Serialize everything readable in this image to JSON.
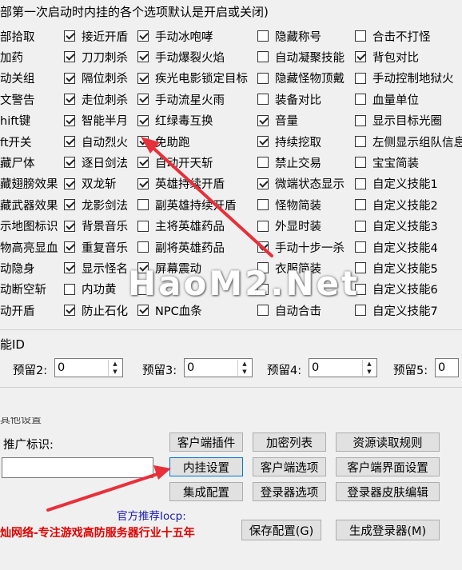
{
  "header": {
    "title": "部第一次启动时内挂的各个选项默认是开启或关闭)"
  },
  "options": {
    "col0": [
      "部拾取",
      "加药",
      "动关组",
      "文警告",
      "hift键",
      "ft开关",
      "藏尸体",
      "藏翅膀效果",
      "藏武器效果",
      "示地图标识",
      "物高亮显血",
      "动隐身",
      "动断空斩",
      "动开盾"
    ],
    "col1": [
      {
        "label": "接近开盾",
        "checked": true
      },
      {
        "label": "刀刀刺杀",
        "checked": true
      },
      {
        "label": "隔位刺杀",
        "checked": true
      },
      {
        "label": "走位刺杀",
        "checked": true
      },
      {
        "label": "智能半月",
        "checked": true
      },
      {
        "label": "自动烈火",
        "checked": true
      },
      {
        "label": "逐日剑法",
        "checked": true
      },
      {
        "label": "双龙斩",
        "checked": true
      },
      {
        "label": "龙影剑法",
        "checked": true
      },
      {
        "label": "背景音乐",
        "checked": true
      },
      {
        "label": "重复音乐",
        "checked": true
      },
      {
        "label": "显示怪名",
        "checked": true
      },
      {
        "label": "内功黄",
        "checked": false
      },
      {
        "label": "防止石化",
        "checked": true
      }
    ],
    "col2": [
      {
        "label": "手动冰咆哮",
        "checked": true
      },
      {
        "label": "手动爆裂火焰",
        "checked": true
      },
      {
        "label": "疾光电影锁定目标",
        "checked": true
      },
      {
        "label": "手动流星火雨",
        "checked": true
      },
      {
        "label": "红绿毒互换",
        "checked": true
      },
      {
        "label": "免助跑",
        "checked": true
      },
      {
        "label": "自动开天斩",
        "checked": true
      },
      {
        "label": "英雄持续开盾",
        "checked": true
      },
      {
        "label": "副英雄持续开盾",
        "checked": false
      },
      {
        "label": "主将英雄药品",
        "checked": false
      },
      {
        "label": "副将英雄药品",
        "checked": false
      },
      {
        "label": "屏幕震动",
        "checked": true
      },
      {
        "label": "",
        "checked": false
      },
      {
        "label": "NPC血条",
        "checked": true
      }
    ],
    "col3": [
      {
        "label": "隐藏称号",
        "checked": false
      },
      {
        "label": "自动凝聚技能",
        "checked": false
      },
      {
        "label": "隐藏怪物顶戴",
        "checked": false
      },
      {
        "label": "装备对比",
        "checked": false
      },
      {
        "label": "音量",
        "checked": true
      },
      {
        "label": "持续挖取",
        "checked": true
      },
      {
        "label": "禁止交易",
        "checked": false
      },
      {
        "label": "微端状态显示",
        "checked": true
      },
      {
        "label": "怪物简装",
        "checked": false
      },
      {
        "label": "外显时装",
        "checked": false
      },
      {
        "label": "手动十步一杀",
        "checked": true
      },
      {
        "label": "衣服简装",
        "checked": false
      },
      {
        "label": "",
        "checked": false
      },
      {
        "label": "自动合击",
        "checked": false
      }
    ],
    "col4": [
      {
        "label": "合击不打怪",
        "checked": false
      },
      {
        "label": "背包对比",
        "checked": true
      },
      {
        "label": "手动控制地狱火",
        "checked": false
      },
      {
        "label": "血量单位",
        "checked": false
      },
      {
        "label": "显示目标光圈",
        "checked": false
      },
      {
        "label": "左侧显示组队信息",
        "checked": false
      },
      {
        "label": "宝宝简装",
        "checked": false
      },
      {
        "label": "自定义技能1",
        "checked": false
      },
      {
        "label": "自定义技能2",
        "checked": false
      },
      {
        "label": "自定义技能3",
        "checked": false
      },
      {
        "label": "自定义技能4",
        "checked": false
      },
      {
        "label": "自定义技能5",
        "checked": false
      },
      {
        "label": "自定义技能6",
        "checked": false
      },
      {
        "label": "自定义技能7",
        "checked": false
      }
    ]
  },
  "skill_id": {
    "section_label": "能ID",
    "reserves": [
      {
        "label": "预留2:",
        "value": "0"
      },
      {
        "label": "预留3:",
        "value": "0"
      },
      {
        "label": "预留4:",
        "value": "0"
      },
      {
        "label": "预留5:",
        "value": "0"
      }
    ]
  },
  "other": {
    "group_label": "其他设置",
    "promo_label": "推广标识:",
    "promo_value": "",
    "buttons": {
      "client_plugin": "客户端插件",
      "encrypt_list": "加密列表",
      "resource_rules": "资源读取规则",
      "plugin_settings": "内挂设置",
      "client_options": "客户端选项",
      "client_ui_settings": "客户端界面设置",
      "integrated_config": "集成配置",
      "launcher_options": "登录器选项",
      "launcher_skin_edit": "登录器皮肤编辑",
      "save_config": "保存配置(G)",
      "generate_launcher": "生成登录器(M)"
    },
    "recommend": "官方推荐Iocp:",
    "promo_text": "灿网络-专注游戏高防服务器行业十五年"
  },
  "watermark": "HaoM2.Net",
  "colors": {
    "arrow": "#e8303a",
    "promo": "#e00000",
    "recommend": "#1a1aaa",
    "focus_border": "#0078d7"
  }
}
